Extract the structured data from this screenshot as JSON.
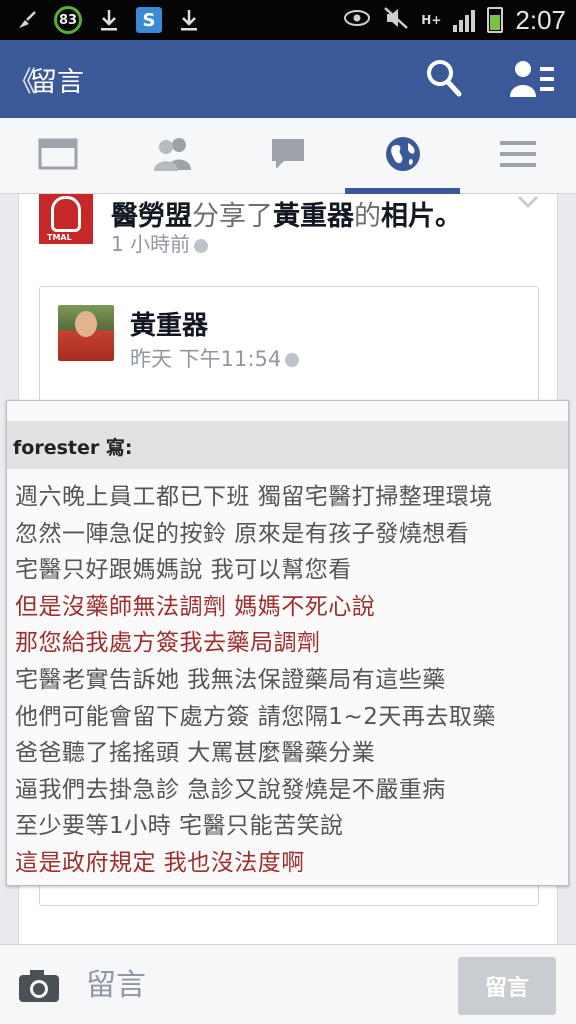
{
  "status_bar": {
    "battery_badge": "83",
    "time": "2:07",
    "network": "H+",
    "icons": [
      "broom-icon",
      "battery-saver-icon",
      "download-icon",
      "s-app-icon",
      "download-icon",
      "eye-icon",
      "mute-icon",
      "network-icon",
      "signal-icon",
      "battery-icon"
    ]
  },
  "header": {
    "back_symbol": "《",
    "title": "留言",
    "brand_color": "#3b5998"
  },
  "tabs": [
    {
      "name": "news-feed",
      "icon": "news-feed-icon",
      "active": false
    },
    {
      "name": "friends",
      "icon": "friends-icon",
      "active": false
    },
    {
      "name": "messages",
      "icon": "chat-icon",
      "active": false
    },
    {
      "name": "notifications",
      "icon": "globe-icon",
      "active": true
    },
    {
      "name": "menu",
      "icon": "hamburger-icon",
      "active": false
    }
  ],
  "post": {
    "page_name": "醫勞盟",
    "shared_text": "分享了",
    "author": "黃重器",
    "possessive": "的",
    "object": "相片。",
    "avatar_caption": "TMAL",
    "timestamp": "1 小時前"
  },
  "shared_post": {
    "author": "黃重器",
    "timestamp": "昨天 下午11:54"
  },
  "quote": {
    "header": "forester 寫:",
    "lines": [
      {
        "text": "週六晚上員工都已下班 獨留宅醫打掃整理環境",
        "highlight": false
      },
      {
        "text": "忽然一陣急促的按鈴 原來是有孩子發燒想看",
        "highlight": false
      },
      {
        "text": "宅醫只好跟媽媽說 我可以幫您看",
        "highlight": false
      },
      {
        "text": "但是沒藥師無法調劑 媽媽不死心說",
        "highlight": true
      },
      {
        "text": "那您給我處方簽我去藥局調劑",
        "highlight": true
      },
      {
        "text": "宅醫老實告訴她 我無法保證藥局有這些藥",
        "highlight": false
      },
      {
        "text": "他們可能會留下處方簽 請您隔1~2天再去取藥",
        "highlight": false
      },
      {
        "text": "爸爸聽了搖搖頭 大罵甚麼醫藥分業",
        "highlight": false
      },
      {
        "text": "逼我們去掛急診 急診又說發燒是不嚴重病",
        "highlight": false
      },
      {
        "text": "至少要等1小時 宅醫只能苦笑說",
        "highlight": false
      },
      {
        "text": "這是政府規定 我也沒法度啊",
        "highlight": true
      }
    ]
  },
  "comment_bar": {
    "placeholder": "留言",
    "post_label": "留言"
  }
}
